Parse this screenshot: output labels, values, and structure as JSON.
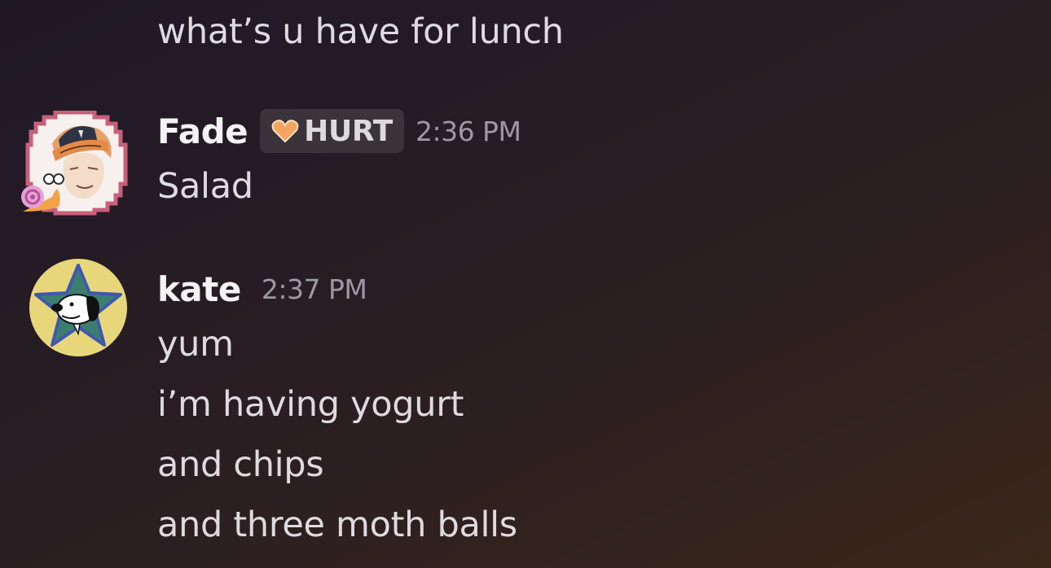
{
  "messages": [
    {
      "continuation": true,
      "lines": [
        "what’s u have for lunch"
      ]
    },
    {
      "author": "Fade",
      "tag": {
        "icon": "heart-icon",
        "label": "HURT",
        "icon_color": "#f3a55f"
      },
      "time": "2:36 PM",
      "avatar": "pixel-frame-avatar",
      "lines": [
        "Salad"
      ]
    },
    {
      "author": "kate",
      "time": "2:37 PM",
      "avatar": "snoopy-star-avatar",
      "lines": [
        "yum",
        "i’m having yogurt",
        "and chips",
        "and three moth balls"
      ]
    }
  ],
  "theme": {
    "author_color": "#f4f2f5",
    "timestamp_color": "#9c98a4",
    "text_color": "#dddbe0",
    "tag_background": "#3a3339"
  }
}
